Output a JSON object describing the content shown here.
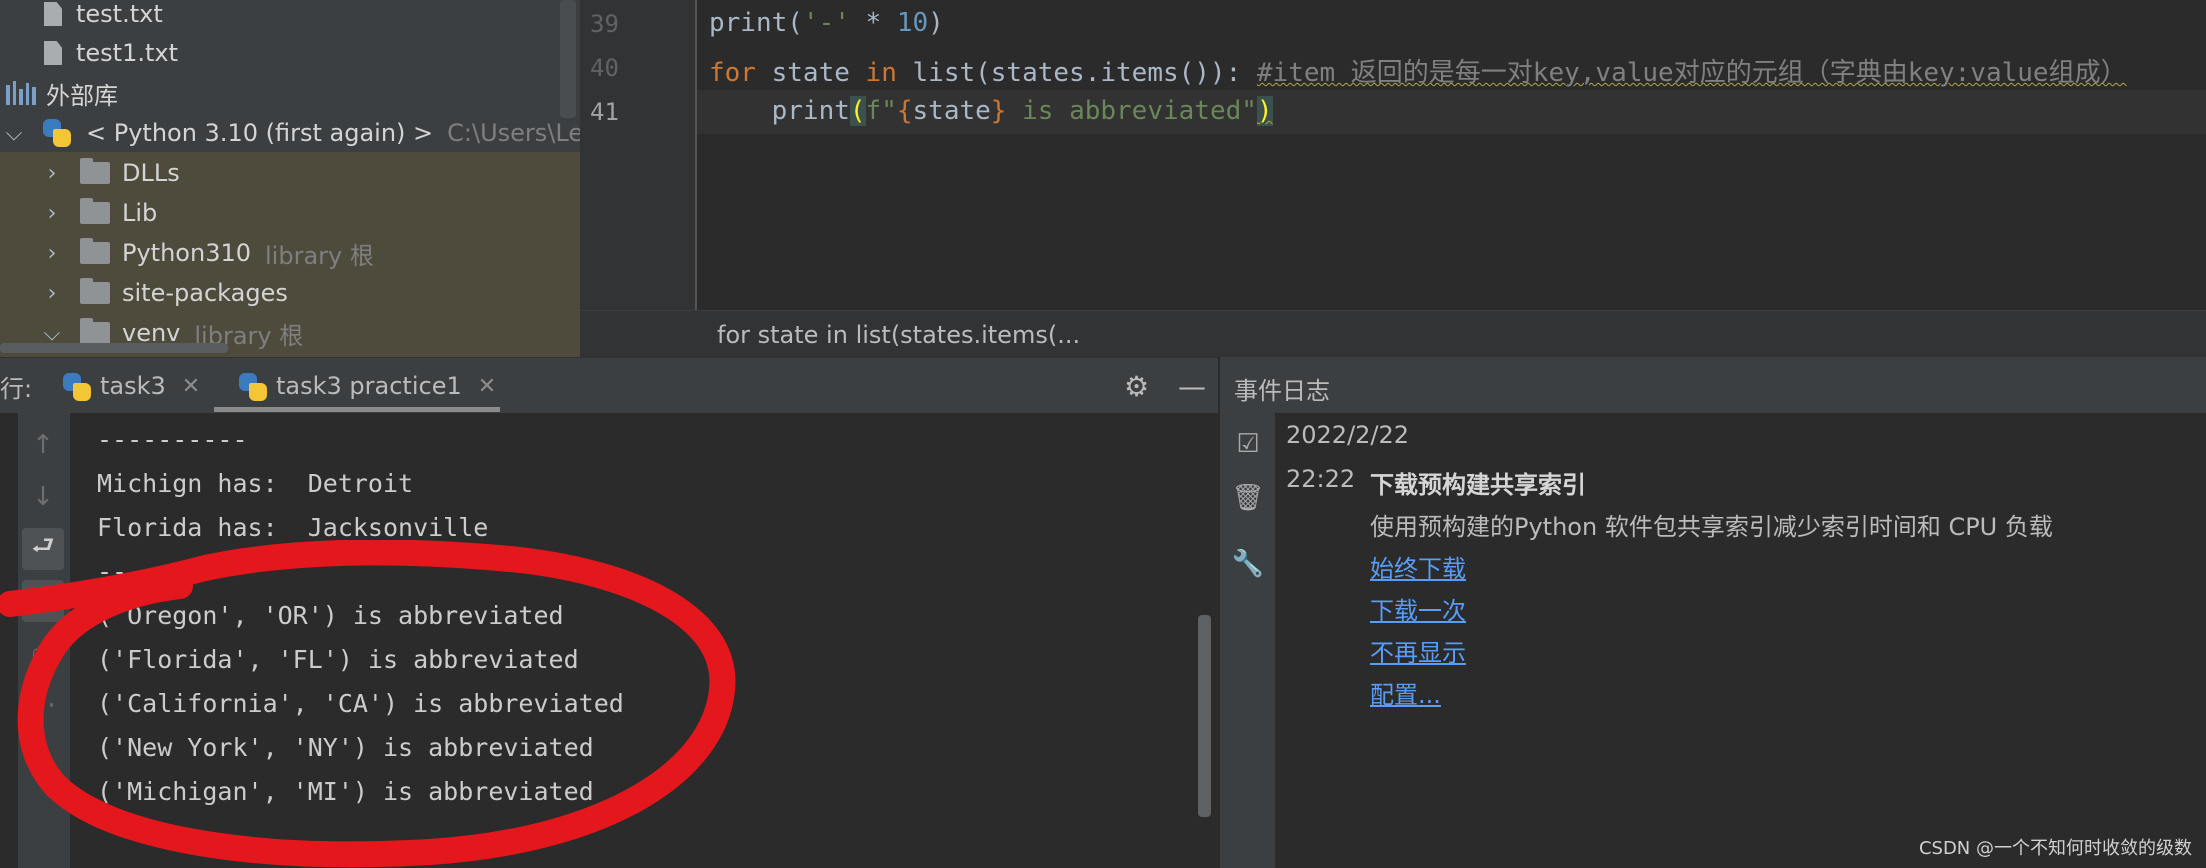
{
  "project_tree": {
    "items": [
      {
        "label": "test.txt",
        "suffix": ""
      },
      {
        "label": "test1.txt",
        "suffix": ""
      },
      {
        "label": "外部库",
        "suffix": ""
      },
      {
        "label": "< Python 3.10 (first again) >",
        "suffix": "C:\\Users\\Lenov"
      },
      {
        "label": "DLLs",
        "suffix": ""
      },
      {
        "label": "Lib",
        "suffix": ""
      },
      {
        "label": "Python310",
        "suffix": "library 根"
      },
      {
        "label": "site-packages",
        "suffix": ""
      },
      {
        "label": "venv",
        "suffix": "library 根"
      }
    ]
  },
  "editor": {
    "line_numbers": [
      "39",
      "40",
      "41"
    ],
    "breadcrumb": "for state in list(states.items(..."
  },
  "run_panel": {
    "label": "行:",
    "tabs": [
      {
        "label": "task3"
      },
      {
        "label": "task3 practice1"
      }
    ],
    "output_lines": [
      "----------",
      "Michign has:  Detroit",
      "Florida has:  Jacksonville",
      "--",
      "('Oregon', 'OR') is abbreviated",
      "('Florida', 'FL') is abbreviated",
      "('California', 'CA') is abbreviated",
      "('New York', 'NY') is abbreviated",
      "('Michigan', 'MI') is abbreviated"
    ]
  },
  "event_log": {
    "title": "事件日志",
    "date": "2022/2/22",
    "time": "22:22",
    "heading": "下载预构建共享索引",
    "message": "使用预构建的Python 软件包共享索引减少索引时间和 CPU 负载",
    "links": [
      "始终下载",
      "下载一次",
      "不再显示",
      "配置..."
    ]
  },
  "watermark": "CSDN @一个不知何时收敛的级数",
  "colors": {
    "annotation_red": "#e3171c",
    "link": "#589df6",
    "keyword": "#cc7832",
    "string": "#6a8759"
  }
}
